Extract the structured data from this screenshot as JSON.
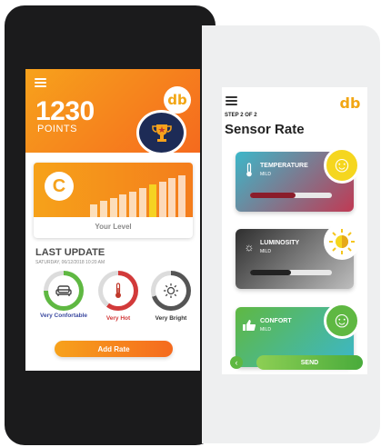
{
  "left_screen": {
    "points_value": "1230",
    "points_label": "POINTS",
    "logo_text": "db",
    "level": {
      "letter": "C",
      "label": "Your Level",
      "bars_count": 10,
      "active_bar": 6
    },
    "last_update": {
      "title": "LAST UPDATE",
      "date": "SATURDAY, 06/12/2018 10:20 AM"
    },
    "gauges": [
      {
        "label": "Very Confortable",
        "color": "#5fb842",
        "fill": 0.75
      },
      {
        "label": "Very Hot",
        "color": "#d23a3a",
        "fill": 0.6
      },
      {
        "label": "Very Bright",
        "color": "#555555",
        "fill": 0.7
      }
    ],
    "add_rate_label": "Add Rate",
    "accent": "#f7a21c"
  },
  "right_screen": {
    "logo_text": "db",
    "step": "STEP 2 OF 2",
    "title": "Sensor Rate",
    "sensors": [
      {
        "name": "TEMPERATURE",
        "sub": "MILD",
        "icon": "thermometer-icon",
        "level": 0.55,
        "color_from": "#3cb7c9",
        "color_to": "#c03a54",
        "track_fill": "#8b1d2b",
        "face_color": "#f5d61f"
      },
      {
        "name": "LUMINOSITY",
        "sub": "MILD",
        "icon": "sun-icon",
        "level": 0.5,
        "color_from": "#2f2f2f",
        "color_to": "#bdbdbd",
        "track_fill": "#222222",
        "face_color": "#f5d61f"
      },
      {
        "name": "CONFORT",
        "sub": "MILD",
        "icon": "thumbs-up-icon",
        "level": 0.5,
        "color_from": "#5fb842",
        "color_to": "#3cb7c9",
        "track_fill": "#2d6f2a",
        "face_color": "#5fb842"
      }
    ],
    "send_label": "SEND",
    "accent": "#5fb842"
  }
}
